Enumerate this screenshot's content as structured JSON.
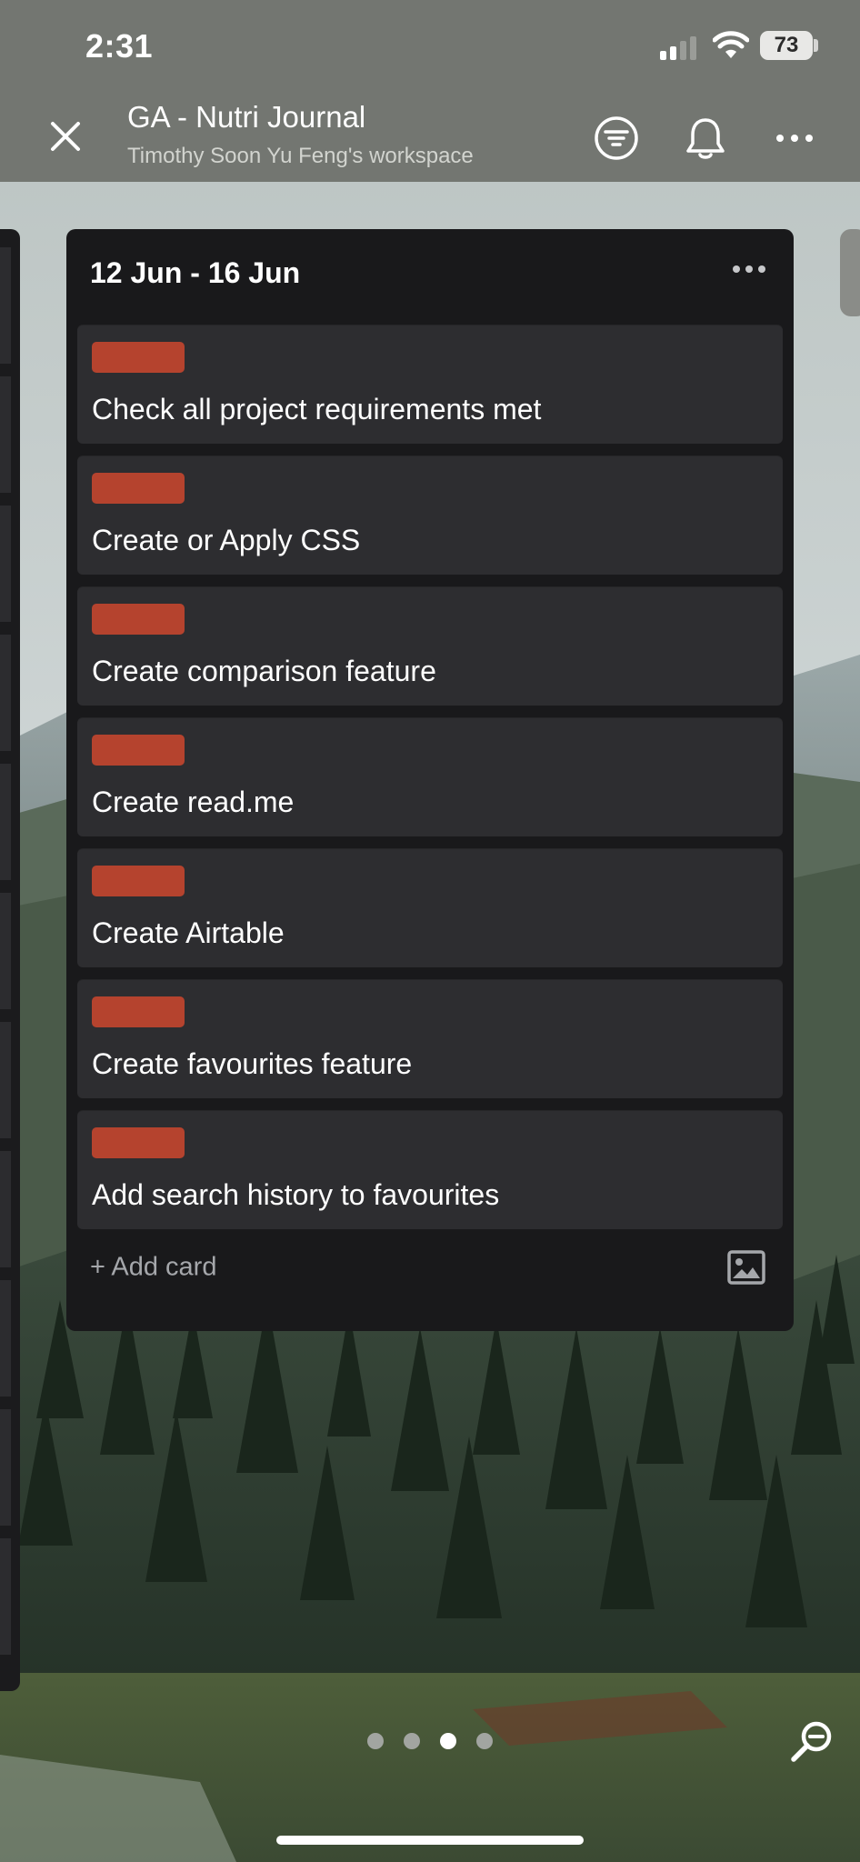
{
  "status_bar": {
    "time": "2:31",
    "battery": "73",
    "icons": [
      "signal-icon",
      "wifi-icon",
      "battery-icon"
    ]
  },
  "header": {
    "title": "GA - Nutri Journal",
    "workspace": "Timothy Soon Yu Feng's workspace",
    "icons": [
      "close-icon",
      "filter-icon",
      "bell-icon",
      "more-icon"
    ]
  },
  "list": {
    "title": "12 Jun - 16 Jun",
    "label_color": "#b5432e",
    "cards": [
      {
        "title": "Check all project requirements met"
      },
      {
        "title": "Create or Apply CSS"
      },
      {
        "title": "Create comparison feature"
      },
      {
        "title": "Create read.me"
      },
      {
        "title": "Create Airtable"
      },
      {
        "title": "Create favourites feature"
      },
      {
        "title": "Add search history to favourites"
      }
    ],
    "add_card": "+ Add card"
  },
  "pager": {
    "total": 4,
    "active_index": 2
  },
  "colors": {
    "header_bg": "#737671",
    "list_bg": "#19191b",
    "card_bg": "#2d2d30",
    "label": "#b5432e"
  }
}
